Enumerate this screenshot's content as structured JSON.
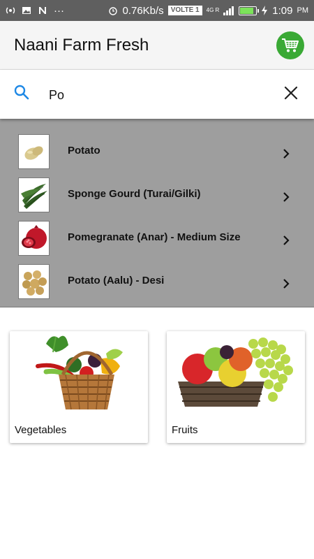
{
  "status_bar": {
    "speed": "0.76Kb/s",
    "volte": "VOLTE 1",
    "network": "4G R",
    "time": "1:09",
    "ampm": "PM",
    "battery_level": 0.85,
    "more_dots": "···"
  },
  "app_bar": {
    "title": "Naani Farm Fresh",
    "cart_icon": "shopping-cart-icon"
  },
  "search": {
    "value": "Po",
    "search_icon": "search-icon",
    "clear_icon": "close-icon"
  },
  "suggestions": [
    {
      "label": "Potato",
      "icon": "potato-thumbnail"
    },
    {
      "label": "Sponge Gourd (Turai/Gilki)",
      "icon": "sponge-gourd-thumbnail"
    },
    {
      "label": "Pomegranate (Anar) - Medium Size",
      "icon": "pomegranate-thumbnail"
    },
    {
      "label": "Potato (Aalu) - Desi",
      "icon": "potato-desi-thumbnail"
    }
  ],
  "categories": [
    {
      "label": "Vegetables",
      "image": "vegetable-basket"
    },
    {
      "label": "Fruits",
      "image": "fruit-basket"
    }
  ],
  "colors": {
    "status_bar": "#5f5f5f",
    "app_bar": "#f5f5f5",
    "accent": "#1e88e5",
    "cart_green": "#3aa935",
    "overlay": "#9e9e9e"
  }
}
